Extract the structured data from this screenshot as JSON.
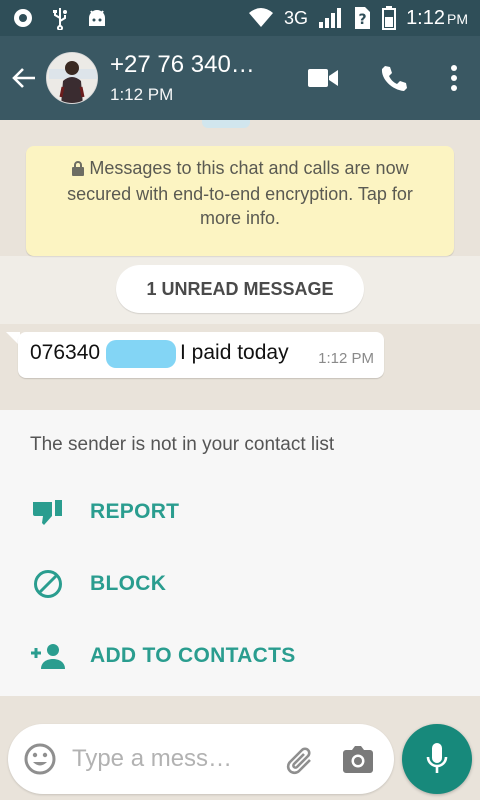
{
  "status_bar": {
    "network": "3G",
    "time": "1:12",
    "ampm": "PM"
  },
  "header": {
    "title": "+27 76 340…",
    "subtitle": "1:12 PM"
  },
  "encryption_notice": "Messages to this chat and calls are now secured with end-to-end encryption. Tap for more info.",
  "unread_label": "1 UNREAD MESSAGE",
  "message": {
    "number_prefix": "076340",
    "text": "I paid today",
    "time": "1:12 PM"
  },
  "sender_panel": {
    "note": "The sender is not in your contact list",
    "options": [
      {
        "label": "REPORT",
        "icon": "thumbs-down-icon"
      },
      {
        "label": "BLOCK",
        "icon": "block-icon"
      },
      {
        "label": "ADD TO CONTACTS",
        "icon": "add-person-icon"
      }
    ]
  },
  "input": {
    "placeholder": "Type a mess…"
  },
  "colors": {
    "statusbar": "#2f4e58",
    "appbar": "#3a5863",
    "accent": "#2a9d8f",
    "fab": "#17897b",
    "encryption_bg": "#fcf4c2"
  }
}
